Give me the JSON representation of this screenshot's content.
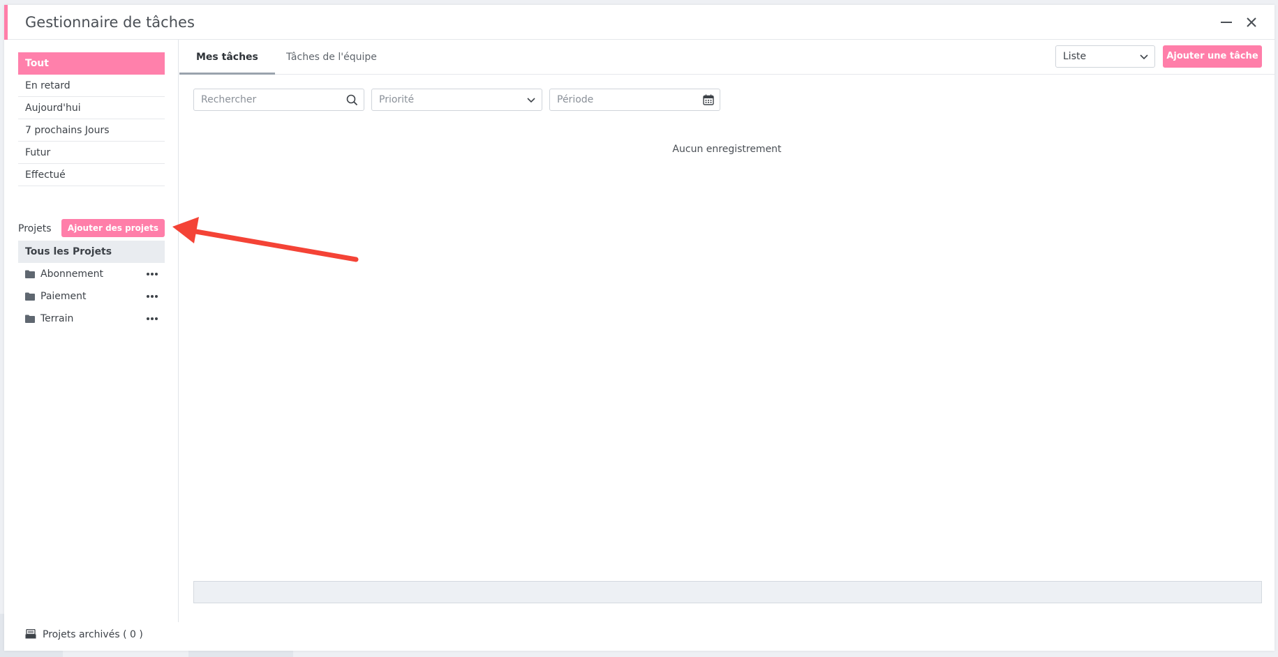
{
  "window": {
    "title": "Gestionnaire de tâches"
  },
  "sidebar": {
    "filters": [
      {
        "label": "Tout",
        "active": true
      },
      {
        "label": "En retard"
      },
      {
        "label": "Aujourd'hui"
      },
      {
        "label": "7 prochains Jours"
      },
      {
        "label": "Futur"
      },
      {
        "label": "Effectué"
      }
    ],
    "projects_label": "Projets",
    "add_projects_label": "Ajouter des projets",
    "all_projects_label": "Tous les Projets",
    "projects": [
      {
        "name": "Abonnement"
      },
      {
        "name": "Paiement"
      },
      {
        "name": "Terrain"
      }
    ],
    "archived_label": "Projets archivés ( 0 )"
  },
  "main": {
    "tabs": [
      {
        "label": "Mes tâches",
        "active": true
      },
      {
        "label": "Tâches de l'équipe"
      }
    ],
    "view_select": {
      "value": "Liste"
    },
    "add_task_label": "Ajouter une tâche",
    "search": {
      "placeholder": "Rechercher"
    },
    "priority": {
      "placeholder": "Priorité"
    },
    "period": {
      "placeholder": "Période"
    },
    "empty_message": "Aucun enregistrement"
  },
  "colors": {
    "accent": "#ff7ea9",
    "annotation": "#f44336"
  },
  "icons": [
    "minimize-icon",
    "close-icon",
    "folder-icon",
    "more-dots-icon",
    "search-icon",
    "chevron-down-icon",
    "calendar-icon",
    "archive-icon",
    "annotation-arrow"
  ]
}
